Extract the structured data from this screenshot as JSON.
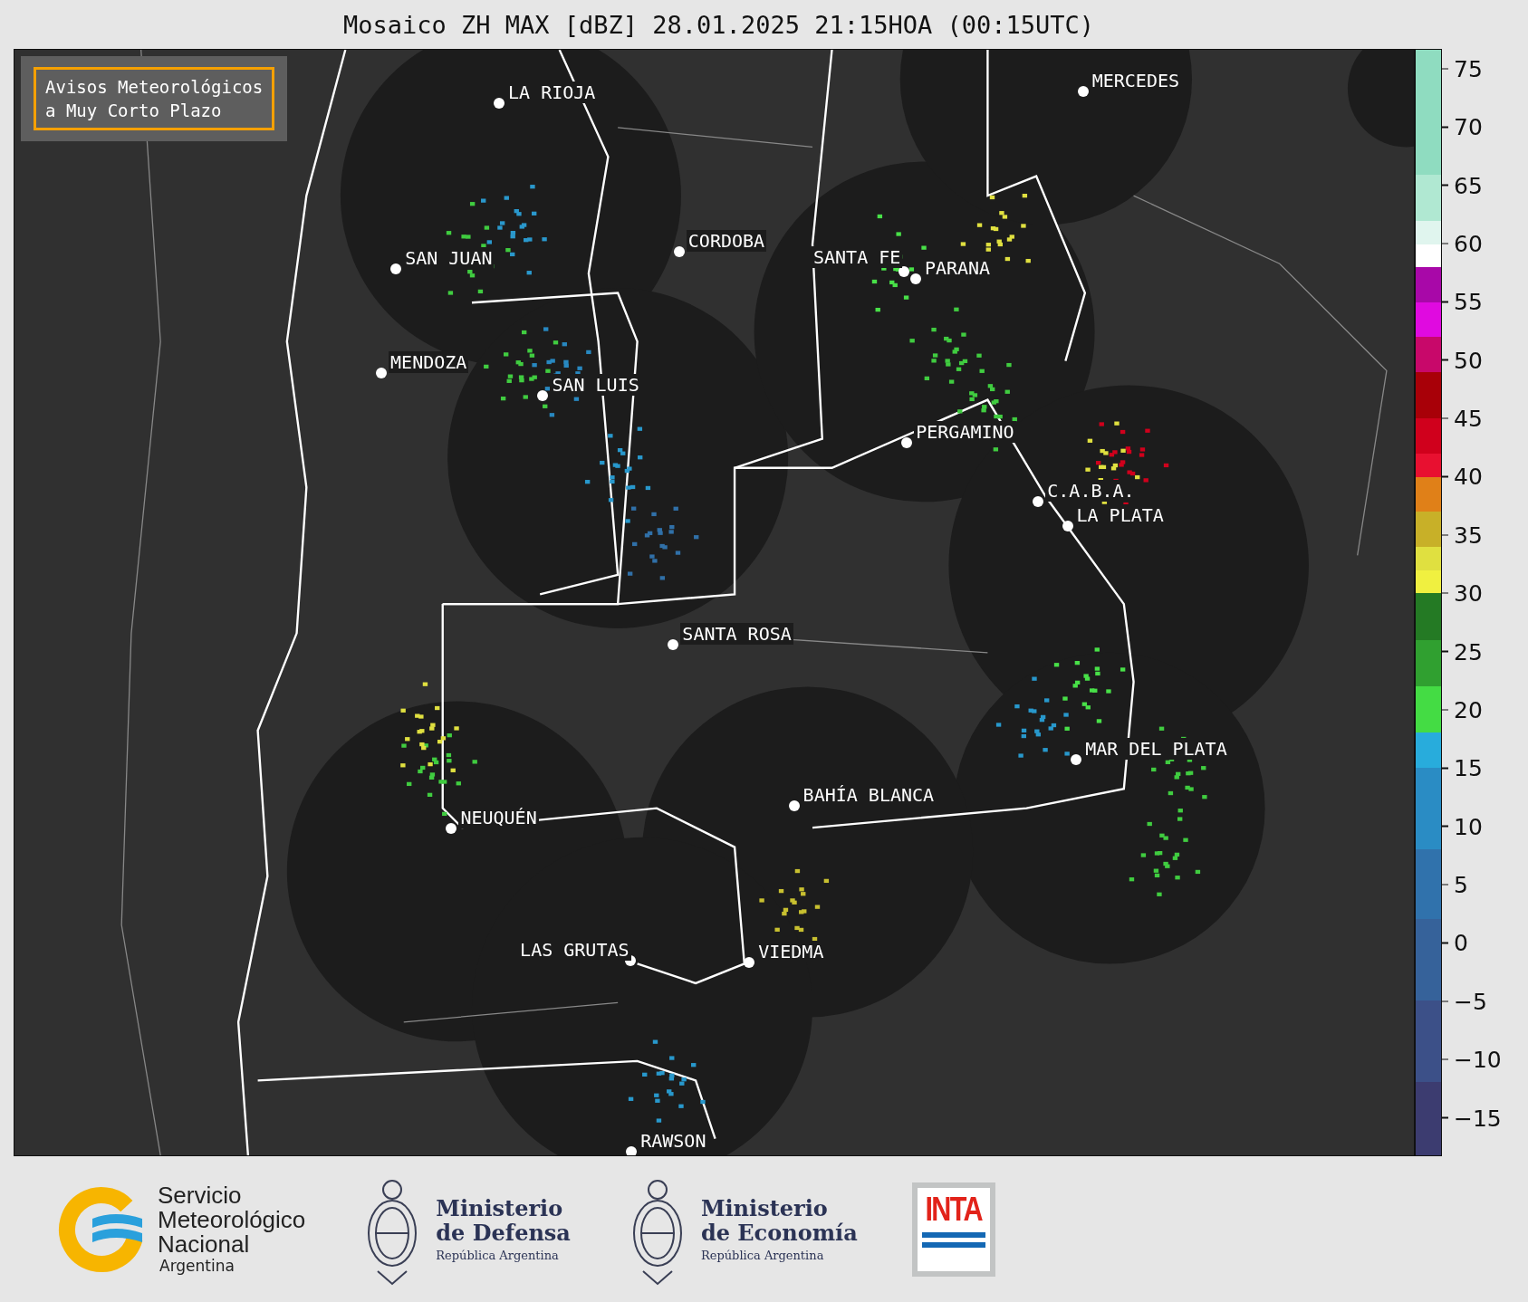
{
  "title": "Mosaico ZH MAX [dBZ] 28.01.2025 21:15HOA (00:15UTC)",
  "notice": {
    "lines": [
      "Avisos Meteorológicos",
      "a Muy Corto Plazo"
    ]
  },
  "cities": [
    {
      "name": "LA RIOJA"
    },
    {
      "name": "MERCEDES"
    },
    {
      "name": "CORDOBA"
    },
    {
      "name": "SAN JUAN"
    },
    {
      "name": "SANTA FE"
    },
    {
      "name": "PARANA"
    },
    {
      "name": "MENDOZA"
    },
    {
      "name": "SAN LUIS"
    },
    {
      "name": "PERGAMINO"
    },
    {
      "name": "C.A.B.A."
    },
    {
      "name": "LA PLATA"
    },
    {
      "name": "SANTA ROSA"
    },
    {
      "name": "MAR DEL PLATA"
    },
    {
      "name": "BAHÍA BLANCA"
    },
    {
      "name": "NEUQUÉN"
    },
    {
      "name": "LAS GRUTAS"
    },
    {
      "name": "VIEDMA"
    },
    {
      "name": "RAWSON"
    }
  ],
  "colorbar": {
    "ticks": [
      "75",
      "70",
      "65",
      "60",
      "55",
      "50",
      "45",
      "40",
      "35",
      "30",
      "25",
      "20",
      "15",
      "10",
      "5",
      "0",
      "−5",
      "−10",
      "−15"
    ]
  },
  "logos": [
    {
      "kind": "smn",
      "lines": [
        "Servicio",
        "Meteorológico",
        "Nacional"
      ],
      "sub": "Argentina"
    },
    {
      "kind": "ministry",
      "lines": [
        "Ministerio",
        "de Defensa"
      ],
      "sub": "República Argentina"
    },
    {
      "kind": "ministry",
      "lines": [
        "Ministerio",
        "de Economía"
      ],
      "sub": "República Argentina"
    },
    {
      "kind": "inta",
      "lines": [
        "INTA"
      ]
    }
  ]
}
